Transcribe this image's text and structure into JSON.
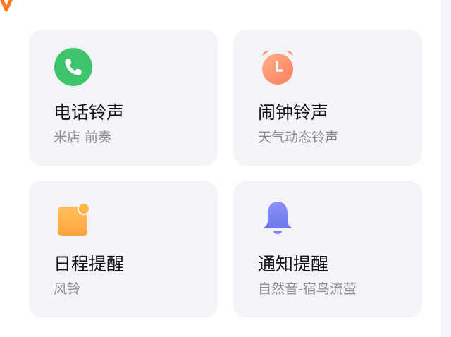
{
  "cards": [
    {
      "title": "电话铃声",
      "subtitle": "米店 前奏",
      "icon": "phone-icon",
      "color": "#3ec46d"
    },
    {
      "title": "闹钟铃声",
      "subtitle": "天气动态铃声",
      "icon": "alarm-clock-icon",
      "color": "#ff8f6b"
    },
    {
      "title": "日程提醒",
      "subtitle": "风铃",
      "icon": "calendar-note-icon",
      "color": "#ffb24a"
    },
    {
      "title": "通知提醒",
      "subtitle": "自然音-宿鸟流萤",
      "icon": "bell-icon",
      "color": "#7d86f2"
    }
  ],
  "colors": {
    "accent_orange": "#ff7a1f",
    "card_bg": "#f3f4f8"
  }
}
